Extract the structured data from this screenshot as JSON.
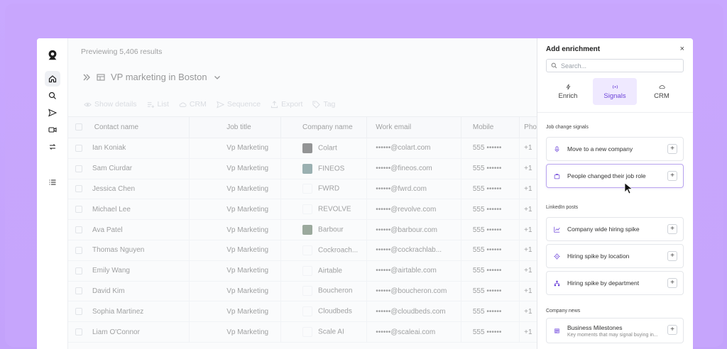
{
  "header": {
    "preview_text": "Previewing 5,406 results",
    "list_title": "VP marketing in Boston"
  },
  "toolbar": [
    {
      "label": "Show details",
      "icon": "eye-icon"
    },
    {
      "label": "List",
      "icon": "list-add-icon"
    },
    {
      "label": "CRM",
      "icon": "cloud-icon"
    },
    {
      "label": "Sequence",
      "icon": "send-icon"
    },
    {
      "label": "Export",
      "icon": "export-icon"
    },
    {
      "label": "Tag",
      "icon": "tag-icon"
    }
  ],
  "table": {
    "columns": [
      "Contact name",
      "Job title",
      "Company name",
      "Work email",
      "Mobile",
      "Pho"
    ],
    "rows": [
      {
        "name": "Ian Koniak",
        "title": "Vp Marketing",
        "company": "Colart",
        "email": "••••••@colart.com",
        "mobile": "555 ••••••",
        "phone": "+1"
      },
      {
        "name": "Sam Ciurdar",
        "title": "Vp Marketing",
        "company": "FINEOS",
        "email": "••••••@fineos.com",
        "mobile": "555 ••••••",
        "phone": "+1"
      },
      {
        "name": "Jessica Chen",
        "title": "Vp Marketing",
        "company": "FWRD",
        "email": "••••••@fwrd.com",
        "mobile": "555 ••••••",
        "phone": "+1"
      },
      {
        "name": "Michael Lee",
        "title": "Vp Marketing",
        "company": "REVOLVE",
        "email": "••••••@revolve.com",
        "mobile": "555 ••••••",
        "phone": "+1"
      },
      {
        "name": "Ava Patel",
        "title": "Vp Marketing",
        "company": "Barbour",
        "email": "••••••@barbour.com",
        "mobile": "555 ••••••",
        "phone": "+1"
      },
      {
        "name": "Thomas Nguyen",
        "title": "Vp Marketing",
        "company": "Cockroach...",
        "email": "••••••@cockrachlab...",
        "mobile": "555 ••••••",
        "phone": "+1"
      },
      {
        "name": "Emily Wang",
        "title": "Vp Marketing",
        "company": "Airtable",
        "email": "••••••@airtable.com",
        "mobile": "555 ••••••",
        "phone": "+1"
      },
      {
        "name": "David Kim",
        "title": "Vp Marketing",
        "company": "Boucheron",
        "email": "••••••@boucheron.com",
        "mobile": "555 ••••••",
        "phone": "+1"
      },
      {
        "name": "Sophia Martinez",
        "title": "Vp Marketing",
        "company": "Cloudbeds",
        "email": "••••••@cloudbeds.com",
        "mobile": "555 ••••••",
        "phone": "+1"
      },
      {
        "name": "Liam O'Connor",
        "title": "Vp Marketing",
        "company": "Scale AI",
        "email": "••••••@scaleai.com",
        "mobile": "555 ••••••",
        "phone": "+1"
      }
    ]
  },
  "panel": {
    "title": "Add enrichment",
    "close": "×",
    "search_placeholder": "Search...",
    "tabs": [
      "Enrich",
      "Signals",
      "CRM"
    ],
    "section_job": "Job change signals",
    "section_linkedin": "LinkedIn posts",
    "section_news": "Company news",
    "job_signals": [
      "Move to a new company",
      "People changed their job role"
    ],
    "linkedin_signals": [
      "Company wide hiring spike",
      "Hiring spike by location",
      "Hiring spike by department"
    ],
    "news_title": "Business Milestones",
    "news_sub": "Key moments that may signal buying in...",
    "plus": "+"
  },
  "colors": {
    "accent": "#6d44d9",
    "accent_bg": "#efe9ff",
    "background": "#c9a8ff"
  }
}
